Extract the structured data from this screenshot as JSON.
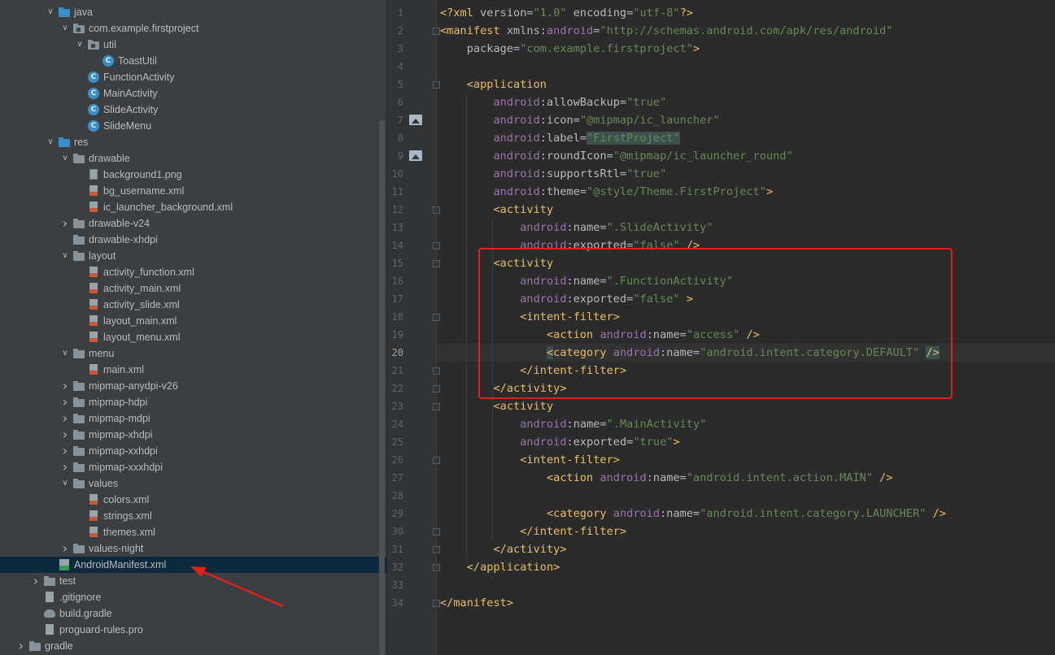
{
  "project_tree": {
    "items": [
      {
        "label": "java",
        "type": "folder-blue",
        "indent": 2,
        "arrow": "down"
      },
      {
        "label": "com.example.firstproject",
        "type": "package",
        "indent": 3,
        "arrow": "down"
      },
      {
        "label": "util",
        "type": "package",
        "indent": 4,
        "arrow": "down"
      },
      {
        "label": "ToastUtil",
        "type": "class",
        "indent": 5,
        "arrow": ""
      },
      {
        "label": "FunctionActivity",
        "type": "class",
        "indent": 4,
        "arrow": ""
      },
      {
        "label": "MainActivity",
        "type": "class",
        "indent": 4,
        "arrow": ""
      },
      {
        "label": "SlideActivity",
        "type": "class",
        "indent": 4,
        "arrow": ""
      },
      {
        "label": "SlideMenu",
        "type": "class",
        "indent": 4,
        "arrow": ""
      },
      {
        "label": "res",
        "type": "folder-res",
        "indent": 2,
        "arrow": "down"
      },
      {
        "label": "drawable",
        "type": "folder",
        "indent": 3,
        "arrow": "down"
      },
      {
        "label": "background1.png",
        "type": "png",
        "indent": 4,
        "arrow": ""
      },
      {
        "label": "bg_username.xml",
        "type": "xml",
        "indent": 4,
        "arrow": ""
      },
      {
        "label": "ic_launcher_background.xml",
        "type": "xml",
        "indent": 4,
        "arrow": ""
      },
      {
        "label": "drawable-v24",
        "type": "folder",
        "indent": 3,
        "arrow": "right"
      },
      {
        "label": "drawable-xhdpi",
        "type": "folder",
        "indent": 3,
        "arrow": ""
      },
      {
        "label": "layout",
        "type": "folder",
        "indent": 3,
        "arrow": "down"
      },
      {
        "label": "activity_function.xml",
        "type": "xml",
        "indent": 4,
        "arrow": ""
      },
      {
        "label": "activity_main.xml",
        "type": "xml",
        "indent": 4,
        "arrow": ""
      },
      {
        "label": "activity_slide.xml",
        "type": "xml",
        "indent": 4,
        "arrow": ""
      },
      {
        "label": "layout_main.xml",
        "type": "xml",
        "indent": 4,
        "arrow": ""
      },
      {
        "label": "layout_menu.xml",
        "type": "xml",
        "indent": 4,
        "arrow": ""
      },
      {
        "label": "menu",
        "type": "folder",
        "indent": 3,
        "arrow": "down"
      },
      {
        "label": "main.xml",
        "type": "xml",
        "indent": 4,
        "arrow": ""
      },
      {
        "label": "mipmap-anydpi-v26",
        "type": "folder",
        "indent": 3,
        "arrow": "right"
      },
      {
        "label": "mipmap-hdpi",
        "type": "folder",
        "indent": 3,
        "arrow": "right"
      },
      {
        "label": "mipmap-mdpi",
        "type": "folder",
        "indent": 3,
        "arrow": "right"
      },
      {
        "label": "mipmap-xhdpi",
        "type": "folder",
        "indent": 3,
        "arrow": "right"
      },
      {
        "label": "mipmap-xxhdpi",
        "type": "folder",
        "indent": 3,
        "arrow": "right"
      },
      {
        "label": "mipmap-xxxhdpi",
        "type": "folder",
        "indent": 3,
        "arrow": "right"
      },
      {
        "label": "values",
        "type": "folder",
        "indent": 3,
        "arrow": "down"
      },
      {
        "label": "colors.xml",
        "type": "xml",
        "indent": 4,
        "arrow": ""
      },
      {
        "label": "strings.xml",
        "type": "xml",
        "indent": 4,
        "arrow": ""
      },
      {
        "label": "themes.xml",
        "type": "xml",
        "indent": 4,
        "arrow": ""
      },
      {
        "label": "values-night",
        "type": "folder",
        "indent": 3,
        "arrow": "right"
      },
      {
        "label": "AndroidManifest.xml",
        "type": "manifest",
        "indent": 2,
        "arrow": "",
        "selected": true
      },
      {
        "label": "test",
        "type": "folder",
        "indent": 1,
        "arrow": "right"
      },
      {
        "label": ".gitignore",
        "type": "file",
        "indent": 1,
        "arrow": ""
      },
      {
        "label": "build.gradle",
        "type": "gradle",
        "indent": 1,
        "arrow": ""
      },
      {
        "label": "proguard-rules.pro",
        "type": "file",
        "indent": 1,
        "arrow": ""
      },
      {
        "label": "gradle",
        "type": "folder",
        "indent": 0,
        "arrow": "right"
      }
    ]
  },
  "editor": {
    "lines": [
      {
        "n": "1",
        "segs": [
          [
            "pi",
            "<?"
          ],
          [
            "tag",
            "xml "
          ],
          [
            "attr",
            "version"
          ],
          [
            "",
            "="
          ],
          [
            "val",
            "\"1.0\""
          ],
          [
            "attr",
            " encoding"
          ],
          [
            "",
            "="
          ],
          [
            "val",
            "\"utf-8\""
          ],
          [
            "pi",
            "?>"
          ]
        ]
      },
      {
        "n": "2",
        "segs": [
          [
            "tag",
            "<manifest "
          ],
          [
            "attr",
            "xmlns:"
          ],
          [
            "ns",
            "android"
          ],
          [
            "",
            "="
          ],
          [
            "val",
            "\"http://schemas.android.com/apk/res/android\""
          ]
        ]
      },
      {
        "n": "3",
        "segs": [
          [
            "",
            "    "
          ],
          [
            "attr",
            "package"
          ],
          [
            "",
            "="
          ],
          [
            "val",
            "\"com.example.firstproject\""
          ],
          [
            "tag",
            ">"
          ]
        ]
      },
      {
        "n": "4",
        "segs": []
      },
      {
        "n": "5",
        "segs": [
          [
            "",
            "    "
          ],
          [
            "tag",
            "<application"
          ]
        ]
      },
      {
        "n": "6",
        "segs": [
          [
            "",
            "        "
          ],
          [
            "ns",
            "android"
          ],
          [
            "attr",
            ":allowBackup"
          ],
          [
            "",
            "="
          ],
          [
            "val",
            "\"true\""
          ]
        ]
      },
      {
        "n": "7",
        "segs": [
          [
            "",
            "        "
          ],
          [
            "ns",
            "android"
          ],
          [
            "attr",
            ":icon"
          ],
          [
            "",
            "="
          ],
          [
            "val",
            "\"@mipmap/ic_launcher\""
          ]
        ]
      },
      {
        "n": "8",
        "segs": [
          [
            "",
            "        "
          ],
          [
            "ns",
            "android"
          ],
          [
            "attr",
            ":label"
          ],
          [
            "",
            "="
          ],
          [
            "val hl",
            "\"FirstProject\""
          ]
        ]
      },
      {
        "n": "9",
        "segs": [
          [
            "",
            "        "
          ],
          [
            "ns",
            "android"
          ],
          [
            "attr",
            ":roundIcon"
          ],
          [
            "",
            "="
          ],
          [
            "val",
            "\"@mipmap/ic_launcher_round\""
          ]
        ]
      },
      {
        "n": "10",
        "segs": [
          [
            "",
            "        "
          ],
          [
            "ns",
            "android"
          ],
          [
            "attr",
            ":supportsRtl"
          ],
          [
            "",
            "="
          ],
          [
            "val",
            "\"true\""
          ]
        ]
      },
      {
        "n": "11",
        "segs": [
          [
            "",
            "        "
          ],
          [
            "ns",
            "android"
          ],
          [
            "attr",
            ":theme"
          ],
          [
            "",
            "="
          ],
          [
            "val",
            "\"@style/Theme.FirstProject\""
          ],
          [
            "tag",
            ">"
          ]
        ]
      },
      {
        "n": "12",
        "segs": [
          [
            "",
            "        "
          ],
          [
            "tag",
            "<activity"
          ]
        ]
      },
      {
        "n": "13",
        "segs": [
          [
            "",
            "            "
          ],
          [
            "ns",
            "android"
          ],
          [
            "attr",
            ":name"
          ],
          [
            "",
            "="
          ],
          [
            "val",
            "\".SlideActivity\""
          ]
        ]
      },
      {
        "n": "14",
        "segs": [
          [
            "",
            "            "
          ],
          [
            "ns",
            "android"
          ],
          [
            "attr",
            ":exported"
          ],
          [
            "",
            "="
          ],
          [
            "val",
            "\"false\""
          ],
          [
            "tag",
            " />"
          ]
        ]
      },
      {
        "n": "15",
        "segs": [
          [
            "",
            "        "
          ],
          [
            "tag",
            "<activity"
          ]
        ]
      },
      {
        "n": "16",
        "segs": [
          [
            "",
            "            "
          ],
          [
            "ns",
            "android"
          ],
          [
            "attr",
            ":name"
          ],
          [
            "",
            "="
          ],
          [
            "val",
            "\".FunctionActivity\""
          ]
        ]
      },
      {
        "n": "17",
        "segs": [
          [
            "",
            "            "
          ],
          [
            "ns",
            "android"
          ],
          [
            "attr",
            ":exported"
          ],
          [
            "",
            "="
          ],
          [
            "val",
            "\"false\""
          ],
          [
            "tag",
            " >"
          ]
        ]
      },
      {
        "n": "18",
        "segs": [
          [
            "",
            "            "
          ],
          [
            "tag",
            "<intent-filter>"
          ]
        ]
      },
      {
        "n": "19",
        "segs": [
          [
            "",
            "                "
          ],
          [
            "tag",
            "<action "
          ],
          [
            "ns",
            "android"
          ],
          [
            "attr",
            ":name"
          ],
          [
            "",
            "="
          ],
          [
            "val",
            "\"access\""
          ],
          [
            "tag",
            " />"
          ]
        ]
      },
      {
        "n": "20",
        "segs": [
          [
            "",
            "                "
          ],
          [
            "tag hl",
            "<"
          ],
          [
            "tag",
            "category "
          ],
          [
            "ns",
            "android"
          ],
          [
            "attr",
            ":name"
          ],
          [
            "",
            "="
          ],
          [
            "val",
            "\"android.intent.category.DEFAULT\""
          ],
          [
            "",
            " "
          ],
          [
            "tag hl",
            "/>"
          ]
        ]
      },
      {
        "n": "21",
        "segs": [
          [
            "",
            "            "
          ],
          [
            "tag",
            "</intent-filter>"
          ]
        ]
      },
      {
        "n": "22",
        "segs": [
          [
            "",
            "        "
          ],
          [
            "tag",
            "</activity>"
          ]
        ]
      },
      {
        "n": "23",
        "segs": [
          [
            "",
            "        "
          ],
          [
            "tag",
            "<activity"
          ]
        ]
      },
      {
        "n": "24",
        "segs": [
          [
            "",
            "            "
          ],
          [
            "ns",
            "android"
          ],
          [
            "attr",
            ":name"
          ],
          [
            "",
            "="
          ],
          [
            "val",
            "\".MainActivity\""
          ]
        ]
      },
      {
        "n": "25",
        "segs": [
          [
            "",
            "            "
          ],
          [
            "ns",
            "android"
          ],
          [
            "attr",
            ":exported"
          ],
          [
            "",
            "="
          ],
          [
            "val",
            "\"true\""
          ],
          [
            "tag",
            ">"
          ]
        ]
      },
      {
        "n": "26",
        "segs": [
          [
            "",
            "            "
          ],
          [
            "tag",
            "<intent-filter>"
          ]
        ]
      },
      {
        "n": "27",
        "segs": [
          [
            "",
            "                "
          ],
          [
            "tag",
            "<action "
          ],
          [
            "ns",
            "android"
          ],
          [
            "attr",
            ":name"
          ],
          [
            "",
            "="
          ],
          [
            "val",
            "\"android.intent.action.MAIN\""
          ],
          [
            "tag",
            " />"
          ]
        ]
      },
      {
        "n": "28",
        "segs": []
      },
      {
        "n": "29",
        "segs": [
          [
            "",
            "                "
          ],
          [
            "tag",
            "<category "
          ],
          [
            "ns",
            "android"
          ],
          [
            "attr",
            ":name"
          ],
          [
            "",
            "="
          ],
          [
            "val",
            "\"android.intent.category.LAUNCHER\""
          ],
          [
            "tag",
            " />"
          ]
        ]
      },
      {
        "n": "30",
        "segs": [
          [
            "",
            "            "
          ],
          [
            "tag",
            "</intent-filter>"
          ]
        ]
      },
      {
        "n": "31",
        "segs": [
          [
            "",
            "        "
          ],
          [
            "tag",
            "</activity>"
          ]
        ]
      },
      {
        "n": "32",
        "segs": [
          [
            "",
            "    "
          ],
          [
            "tag",
            "</application>"
          ]
        ]
      },
      {
        "n": "33",
        "segs": []
      },
      {
        "n": "34",
        "segs": [
          [
            "tag",
            "</manifest>"
          ]
        ]
      }
    ]
  },
  "colors": {
    "highlight_box": "#e0201c",
    "annotation_arrow": "#e0201c",
    "selection": "#0d293e"
  }
}
